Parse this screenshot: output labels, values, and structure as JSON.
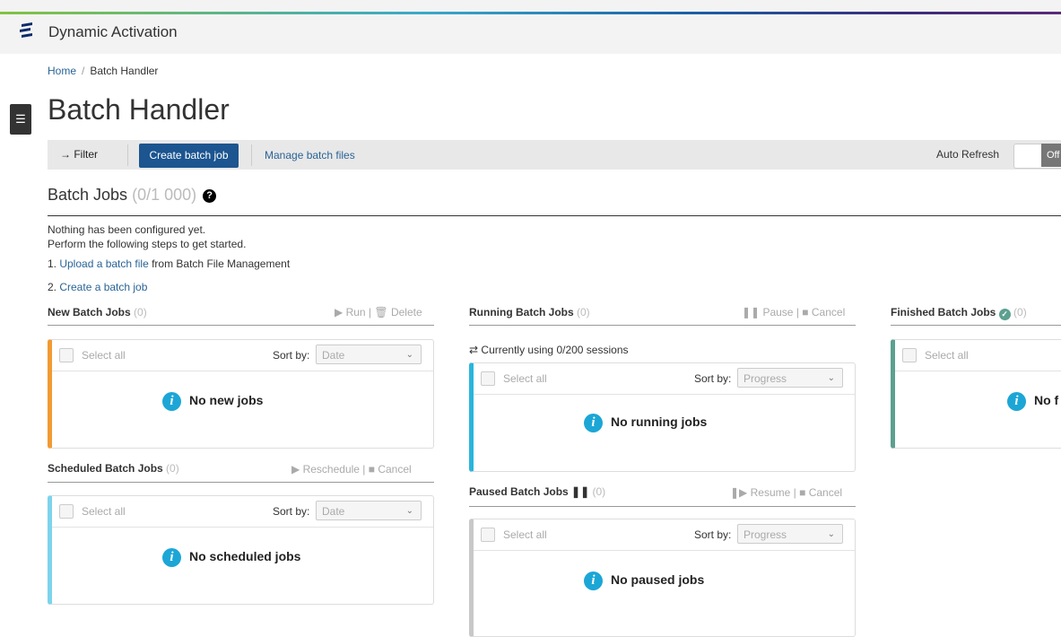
{
  "colors": {
    "new_accent": "#f29a33",
    "scheduled_accent": "#7dd4ec",
    "running_accent": "#29b5dc",
    "paused_accent": "#c8c8c8",
    "finished_accent": "#5ca090",
    "primary": "#1c5590"
  },
  "header": {
    "app_title": "Dynamic Activation",
    "logo_icon": "ericsson-logo"
  },
  "breadcrumb": {
    "home": "Home",
    "separator": "/",
    "current": "Batch Handler"
  },
  "page_title": "Batch Handler",
  "toolbar": {
    "filter_label": "→ Filter",
    "create_label": "Create batch job",
    "manage_label": "Manage batch files",
    "auto_refresh_label": "Auto Refresh",
    "toggle_state": "Off"
  },
  "jobs": {
    "heading": "Batch Jobs",
    "count": "(0/1 000)",
    "help": "?"
  },
  "getting_started": {
    "line1": "Nothing has been configured yet.",
    "line2": "Perform the following steps to get started.",
    "step1_num": "1. ",
    "step1_link": "Upload a batch file",
    "step1_rest": " from Batch File Management",
    "step2_num": "2. ",
    "step2_link": "Create a batch job"
  },
  "new_jobs": {
    "title": "New Batch Jobs",
    "count": "(0)",
    "run": "Run",
    "delete": "Delete",
    "select_all": "Select all",
    "sort_by": "Sort by:",
    "sort_value": "Date",
    "empty": "No new jobs"
  },
  "scheduled_jobs": {
    "title": "Scheduled Batch Jobs",
    "count": "(0)",
    "reschedule": "Reschedule",
    "cancel": "Cancel",
    "select_all": "Select all",
    "sort_by": "Sort by:",
    "sort_value": "Date",
    "empty": "No scheduled jobs"
  },
  "running_jobs": {
    "title": "Running Batch Jobs",
    "count": "(0)",
    "pause": "Pause",
    "cancel": "Cancel",
    "sessions": "Currently using 0/200 sessions",
    "select_all": "Select all",
    "sort_by": "Sort by:",
    "sort_value": "Progress",
    "empty": "No running jobs"
  },
  "paused_jobs": {
    "title": "Paused Batch Jobs",
    "count": "(0)",
    "resume": "Resume",
    "cancel": "Cancel",
    "select_all": "Select all",
    "sort_by": "Sort by:",
    "sort_value": "Progress",
    "empty": "No paused jobs"
  },
  "finished_jobs": {
    "title": "Finished Batch Jobs",
    "count": "(0)",
    "select_all": "Select all",
    "empty": "No f"
  }
}
